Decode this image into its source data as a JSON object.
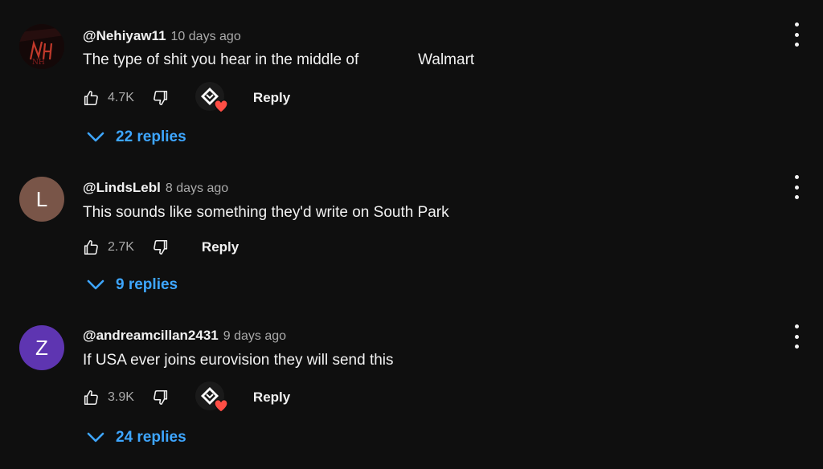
{
  "comments": [
    {
      "author": "@Nehiyaw11",
      "time": "10 days ago",
      "text": "The type of shit you hear in the middle of              Walmart",
      "likes": "4.7K",
      "reply_label": "Reply",
      "replies_label": "22 replies",
      "avatar_type": "image",
      "creator_heart": true
    },
    {
      "author": "@LindsLebl",
      "time": "8 days ago",
      "text": "This sounds like something they'd write on South Park",
      "likes": "2.7K",
      "reply_label": "Reply",
      "replies_label": "9 replies",
      "avatar_letter": "L",
      "avatar_color": "#795548",
      "creator_heart": false
    },
    {
      "author": "@andreamcillan2431",
      "time": "9 days ago",
      "text": "If USA ever joins eurovision they will send this",
      "likes": "3.9K",
      "reply_label": "Reply",
      "replies_label": "24 replies",
      "avatar_letter": "Z",
      "avatar_color": "#5e35b1",
      "creator_heart": true
    }
  ],
  "avatar_image_text": "NH",
  "colors": {
    "background": "#0f0f0f",
    "link": "#3ea6ff",
    "heart": "#ff4e45",
    "muted": "#aaaaaa"
  }
}
